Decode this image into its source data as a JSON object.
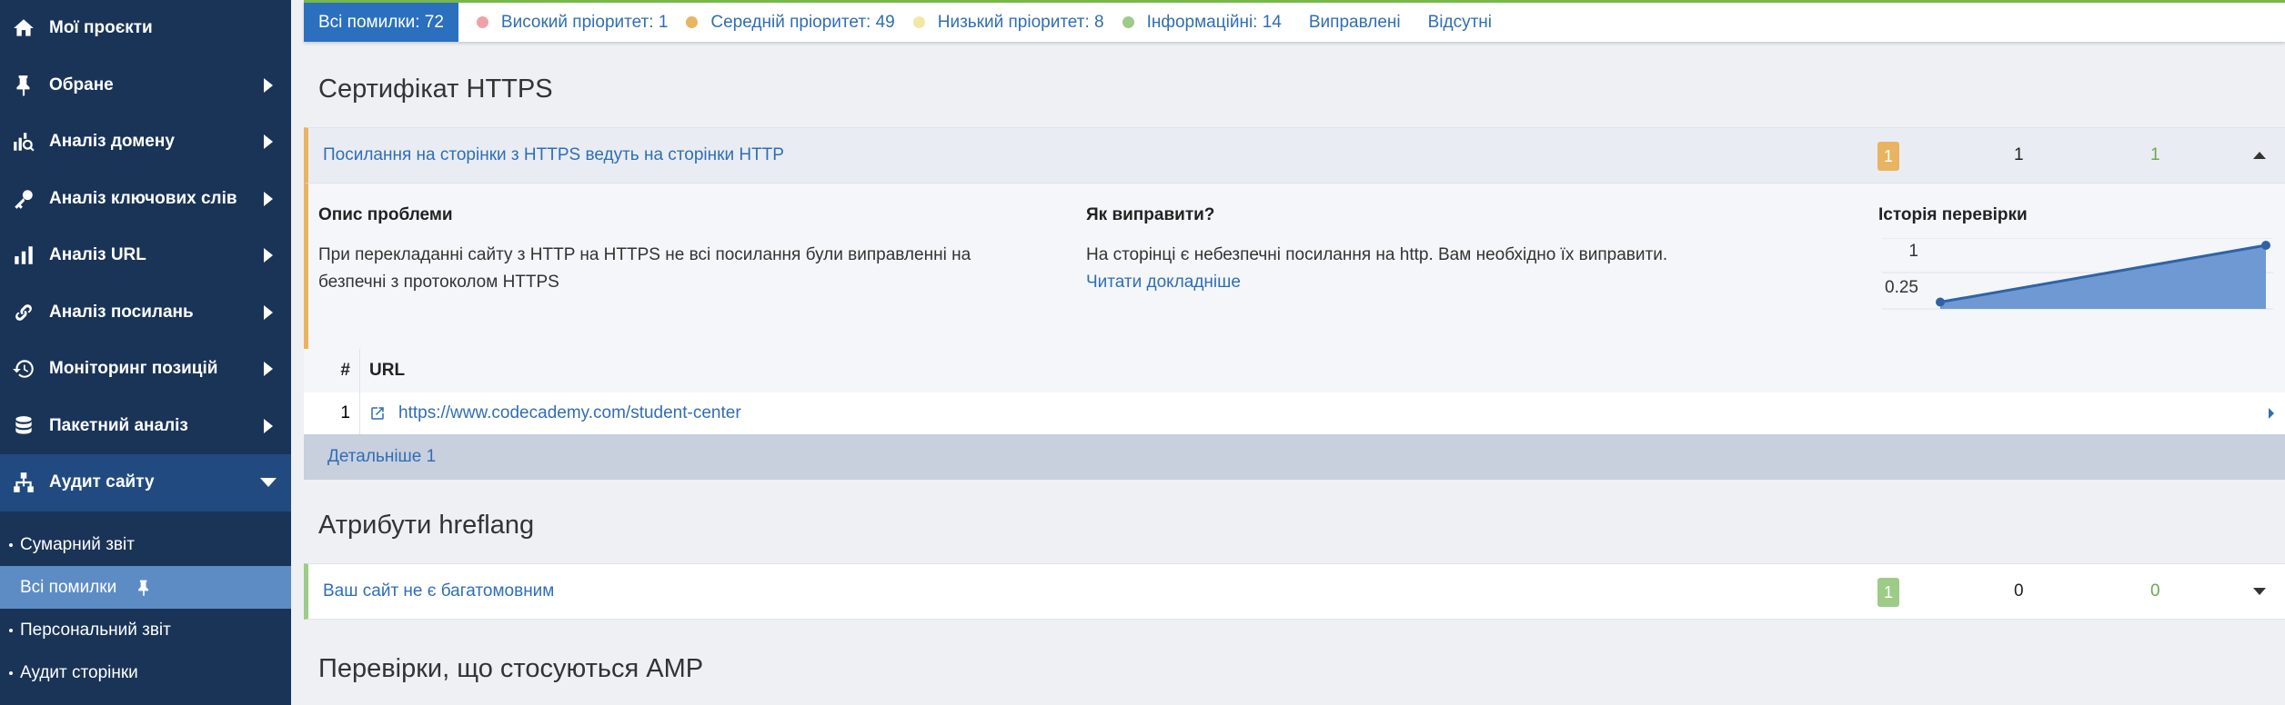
{
  "sidebar": {
    "items": [
      {
        "label": "Мої проєкти",
        "icon": "home-icon"
      },
      {
        "label": "Обране",
        "icon": "pin-icon"
      },
      {
        "label": "Аналіз домену",
        "icon": "domain-analysis-icon"
      },
      {
        "label": "Аналіз ключових слів",
        "icon": "key-icon"
      },
      {
        "label": "Аналіз URL",
        "icon": "bar-chart-icon"
      },
      {
        "label": "Аналіз посилань",
        "icon": "link-icon"
      },
      {
        "label": "Моніторинг позицій",
        "icon": "history-icon"
      },
      {
        "label": "Пакетний аналіз",
        "icon": "database-icon"
      },
      {
        "label": "Аудит сайту",
        "icon": "sitemap-icon"
      }
    ],
    "sub_items": [
      {
        "label": "Сумарний звіт"
      },
      {
        "label": "Всі помилки"
      },
      {
        "label": "Персональний звіт"
      },
      {
        "label": "Аудит сторінки"
      }
    ]
  },
  "filters": {
    "all": "Всі помилки: 72",
    "high": "Високий пріоритет: 1",
    "medium": "Середній пріоритет: 49",
    "low": "Низький пріоритет: 8",
    "info": "Інформаційні: 14",
    "fixed": "Виправлені",
    "missing": "Відсутні",
    "colors": {
      "high": "#f2a0a8",
      "medium": "#e8b461",
      "low": "#f3e7a6",
      "info": "#9ccc87"
    }
  },
  "sections": {
    "https": {
      "title": "Сертифікат HTTPS",
      "issue": {
        "title": "Посилання на сторінки з HTTPS ведуть на сторінки HTTP",
        "badge": "1",
        "count_a": "1",
        "count_b": "1",
        "badge_color": "#e8b461"
      },
      "details": {
        "problem_header": "Опис проблеми",
        "problem_text_1": "При перекладанні сайту з HTTP на HTTPS не всі посилання були виправленні на",
        "problem_text_2": "безпечні з протоколом HTTPS",
        "fix_header": "Як виправити?",
        "fix_text": "На сторінці є небезпечні посилання на http. Вам необхідно їх виправити.",
        "read_more": "Читати докладніше",
        "history_header": "Історія перевірки",
        "history_labels": [
          "1",
          "0.25"
        ]
      },
      "table": {
        "col_num": "#",
        "col_url": "URL",
        "rows": [
          {
            "num": "1",
            "url": "https://www.codecademy.com/student-center"
          }
        ],
        "more": "Детальніше 1"
      }
    },
    "hreflang": {
      "title": "Атрибути hreflang",
      "issue": {
        "title": "Ваш сайт не є багатомовним",
        "badge": "1",
        "count_a": "0",
        "count_b": "0",
        "badge_color": "#9ccc87"
      }
    },
    "amp": {
      "title": "Перевірки, що стосуються AMP"
    }
  },
  "chart_data": {
    "type": "area",
    "x": [
      1,
      2
    ],
    "values": [
      0.25,
      1
    ],
    "y_ticks": [
      "1",
      "0.25"
    ]
  }
}
